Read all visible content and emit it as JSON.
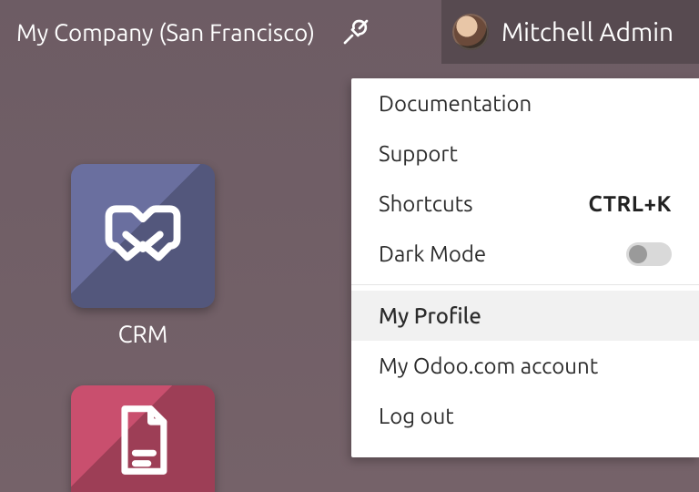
{
  "topbar": {
    "company": "My Company (San Francisco)",
    "username": "Mitchell Admin"
  },
  "dropdown": {
    "documentation": "Documentation",
    "support": "Support",
    "shortcuts_label": "Shortcuts",
    "shortcuts_kbd": "CTRL+K",
    "darkmode_label": "Dark Mode",
    "my_profile": "My Profile",
    "odoo_account": "My Odoo.com account",
    "logout": "Log out"
  },
  "apps": {
    "crm_label": "CRM"
  }
}
